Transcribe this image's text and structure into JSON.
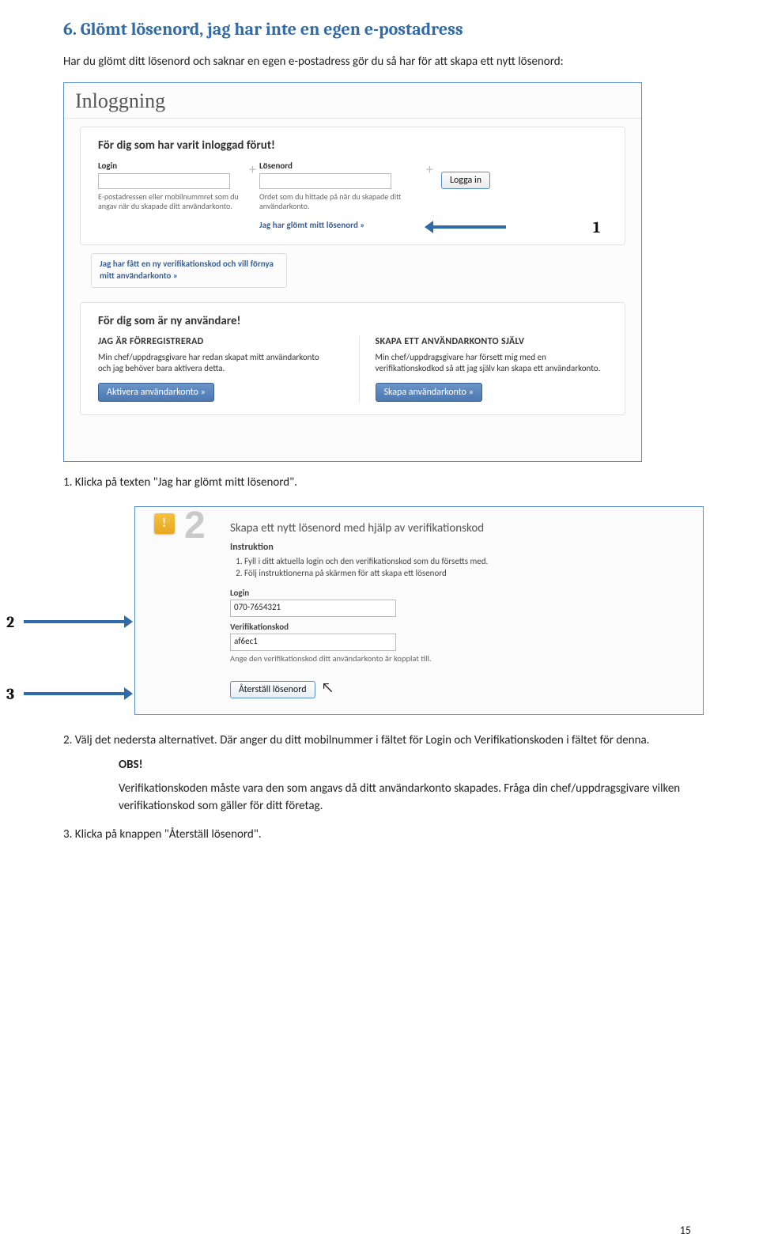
{
  "section": {
    "title": "6. Glömt lösenord, jag har inte en egen e-postadress",
    "intro": "Har du glömt ditt lösenord och saknar en egen e-postadress gör du så har för att skapa ett nytt lösenord:"
  },
  "shot1": {
    "window_title": "Inloggning",
    "panel1": {
      "heading": "För dig som har varit inloggad förut!",
      "login_label": "Login",
      "login_hint": "E-postadressen eller mobilnummret som du angav när du skapade ditt användarkonto.",
      "password_label": "Lösenord",
      "password_hint": "Ordet som du hittade på när du skapade ditt användarkonto.",
      "login_btn": "Logga in",
      "forgot_link": "Jag har glömt mitt lösenord »"
    },
    "verif_box": "Jag har fått en ny verifikationskod och vill förnya mitt användarkonto »",
    "panel2": {
      "heading": "För dig som är ny användare!",
      "col1_title": "JAG ÄR FÖRREGISTRERAD",
      "col1_body": "Min chef/uppdragsgivare har redan skapat mitt användarkonto och jag behöver bara aktivera detta.",
      "col1_btn": "Aktivera användarkonto »",
      "col2_title": "SKAPA ETT ANVÄNDARKONTO SJÄLV",
      "col2_body": "Min chef/uppdragsgivare har försett mig med en verifikationskodkod så att jag själv kan skapa ett användarkonto.",
      "col2_btn": "Skapa användarkonto »"
    }
  },
  "annot": {
    "n1": "1",
    "n2": "2",
    "n3": "3"
  },
  "steps": {
    "s1": "1. Klicka på texten \"Jag har glömt mitt lösenord\"."
  },
  "shot2": {
    "big_step": "2",
    "title": "Skapa ett nytt lösenord med hjälp av verifikationskod",
    "sub": "Instruktion",
    "li1": "Fyll i ditt aktuella login och den verifikationskod som du försetts med.",
    "li2": "Följ instruktionerna på skärmen för att skapa ett lösenord",
    "login_label": "Login",
    "login_value": "070-7654321",
    "verif_label": "Verifikationskod",
    "verif_value": "af6ec1",
    "verif_hint": "Ange den verifikationskod ditt användarkonto är kopplat till.",
    "reset_btn": "Återställ lösenord"
  },
  "post_steps": {
    "s2": "2. Välj det nedersta alternativet. Där anger du ditt mobilnummer i fältet för Login och Verifikationskoden i fältet för denna.",
    "obs_title": "OBS!",
    "obs_body1": "Verifikationskoden måste vara den som angavs då ditt användarkonto skapades. Fråga din chef/uppdragsgivare vilken verifikationskod som gäller för ditt företag.",
    "s3": "3. Klicka på knappen \"Återställ lösenord\"."
  },
  "page_number": "15"
}
